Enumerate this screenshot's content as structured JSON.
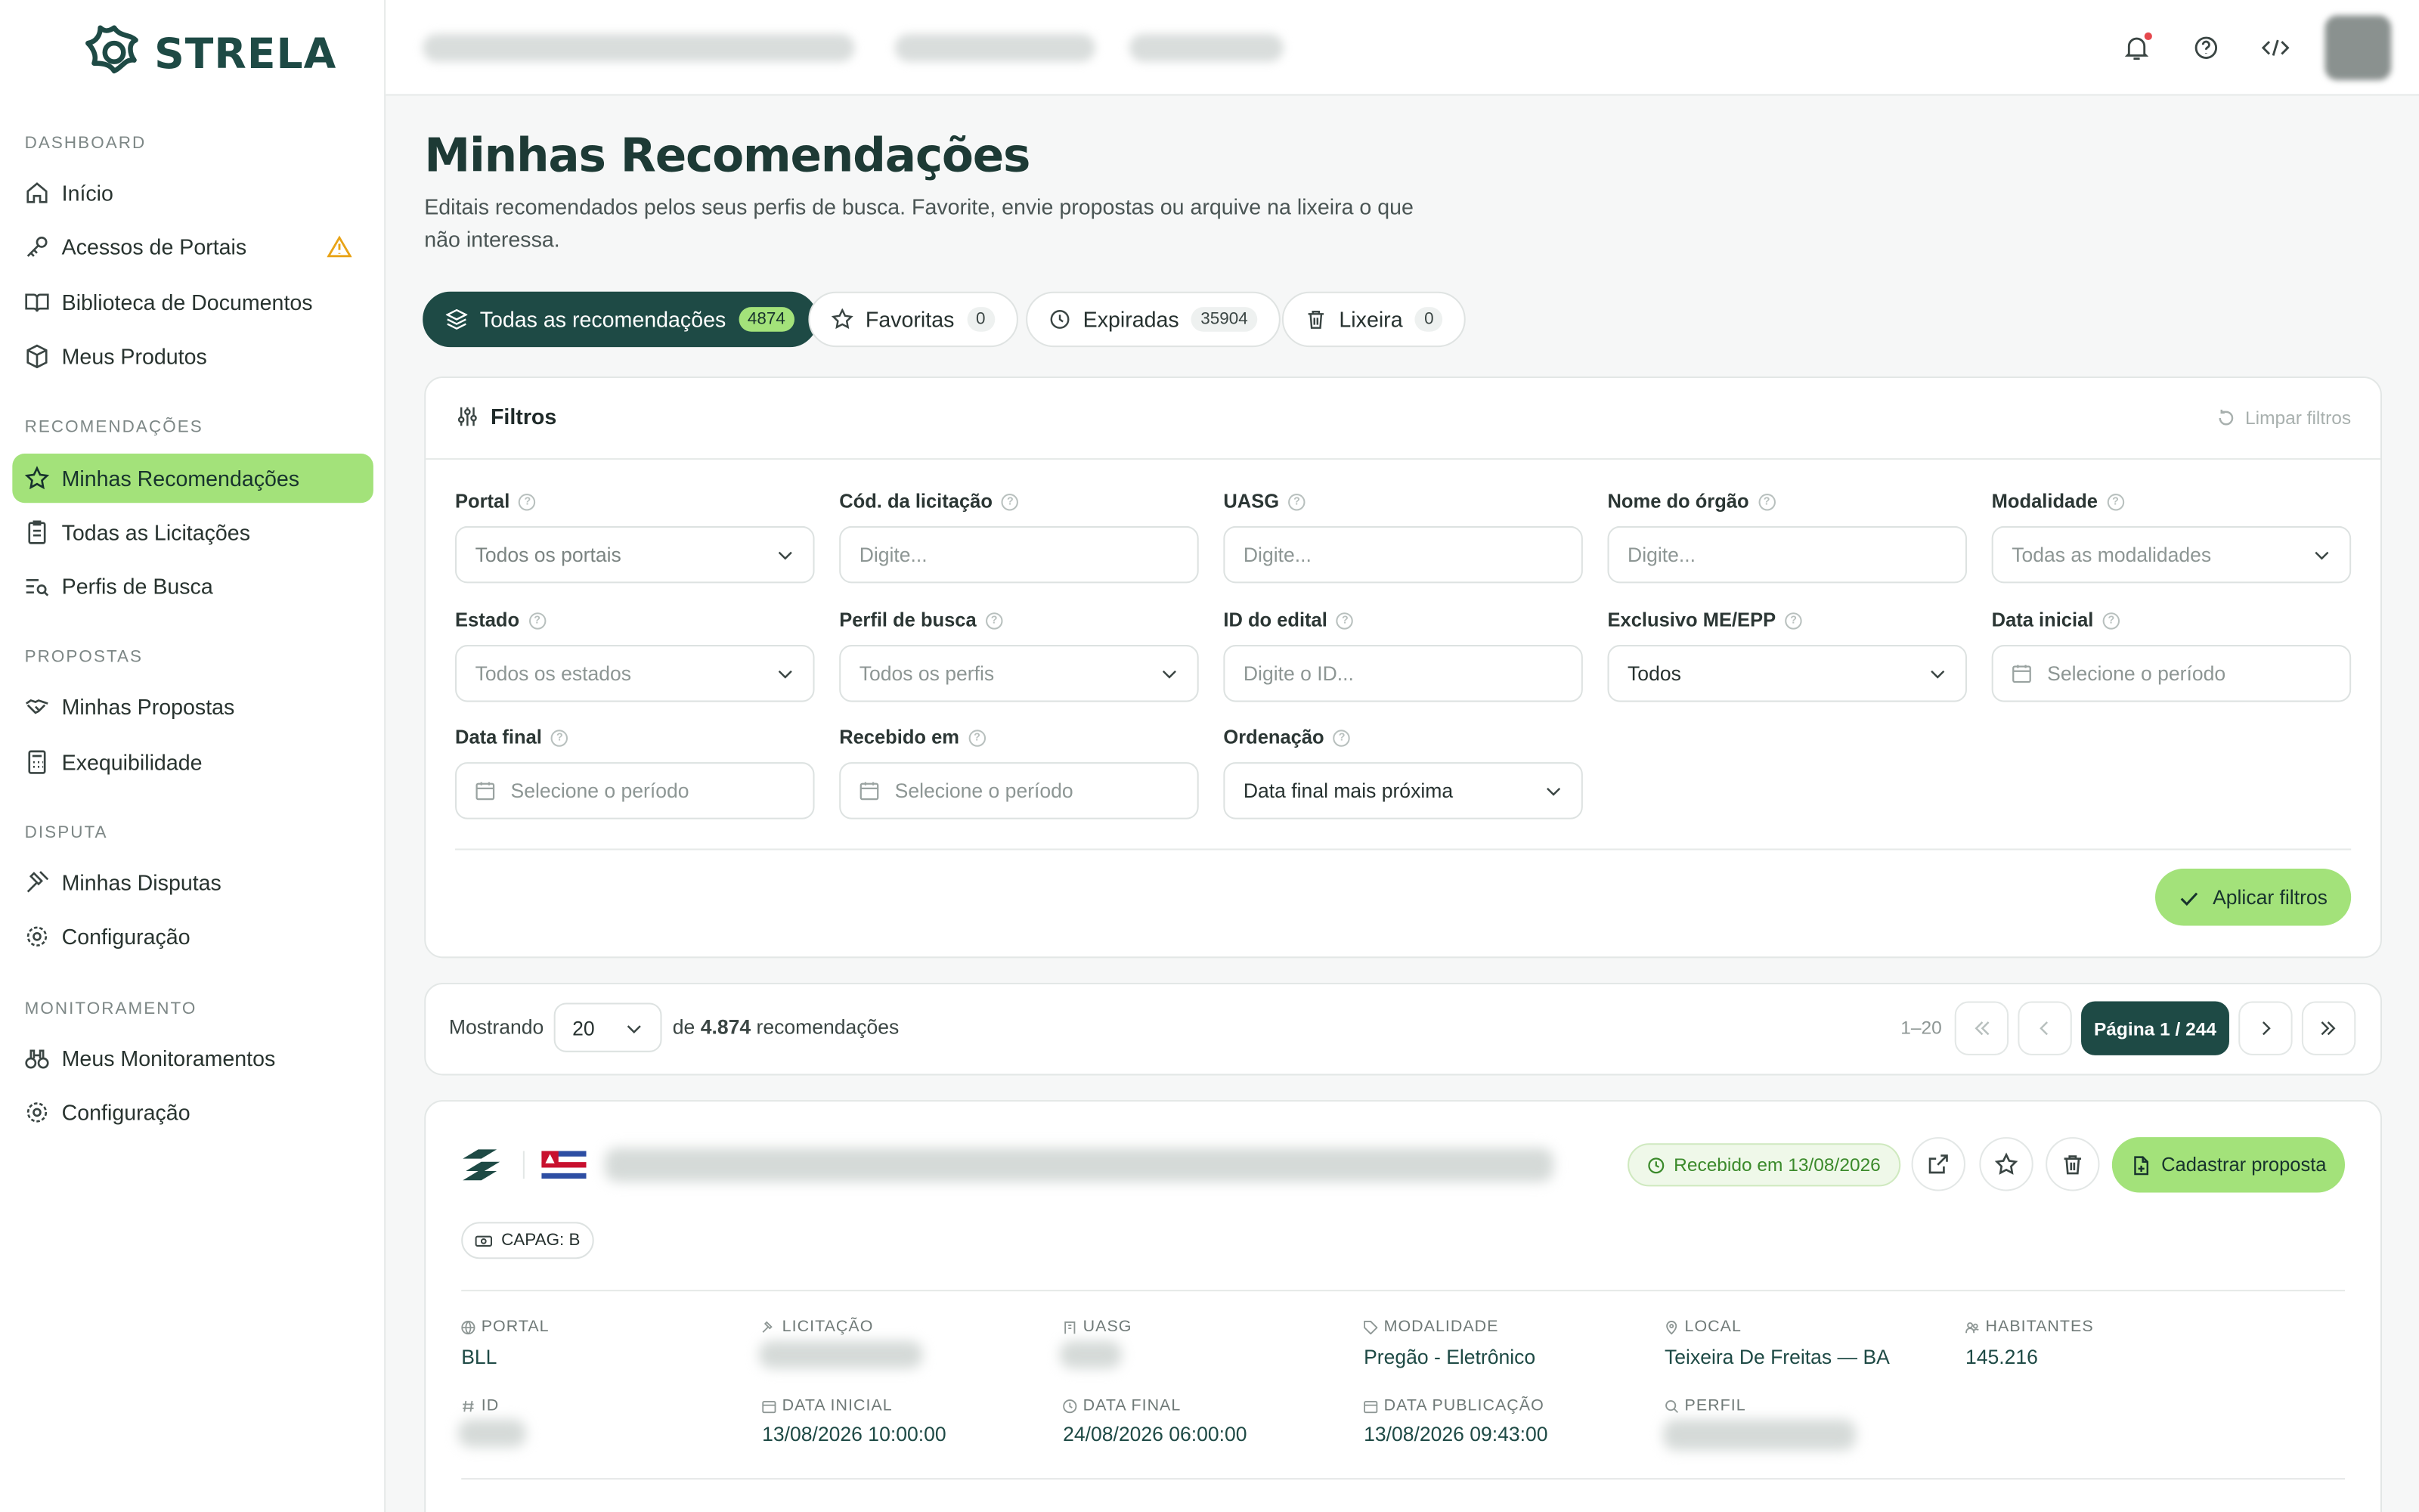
{
  "app": {
    "brand": "STRELA"
  },
  "sidebar": {
    "sections": [
      {
        "title": "DASHBOARD",
        "items": [
          {
            "label": "Início",
            "icon": "home-icon"
          },
          {
            "label": "Acessos de Portais",
            "icon": "key-icon",
            "warning": true
          },
          {
            "label": "Biblioteca de Documentos",
            "icon": "book-icon"
          },
          {
            "label": "Meus Produtos",
            "icon": "package-icon"
          }
        ]
      },
      {
        "title": "RECOMENDAÇÕES",
        "items": [
          {
            "label": "Minhas Recomendações",
            "icon": "star-icon",
            "active": true
          },
          {
            "label": "Todas as Licitações",
            "icon": "clipboard-icon"
          },
          {
            "label": "Perfis de Busca",
            "icon": "list-search-icon"
          }
        ]
      },
      {
        "title": "PROPOSTAS",
        "items": [
          {
            "label": "Minhas Propostas",
            "icon": "handshake-icon"
          },
          {
            "label": "Exequibilidade",
            "icon": "calculator-icon"
          }
        ]
      },
      {
        "title": "DISPUTA",
        "items": [
          {
            "label": "Minhas Disputas",
            "icon": "gavel-icon"
          },
          {
            "label": "Configuração",
            "icon": "gear-icon"
          }
        ]
      },
      {
        "title": "MONITORAMENTO",
        "items": [
          {
            "label": "Meus Monitoramentos",
            "icon": "binoculars-icon"
          },
          {
            "label": "Configuração",
            "icon": "gear-icon"
          }
        ]
      }
    ]
  },
  "header": {
    "icons": [
      "bell-icon",
      "help-icon",
      "code-icon"
    ]
  },
  "main": {
    "title": "Minhas Recomendações",
    "subtitle": "Editais recomendados pelos seus perfis de busca. Favorite, envie propostas ou arquive na lixeira o que não interessa.",
    "tabs": [
      {
        "label": "Todas as recomendações",
        "count": "4874",
        "active": true
      },
      {
        "label": "Favoritas",
        "count": "0"
      },
      {
        "label": "Expiradas",
        "count": "35904"
      },
      {
        "label": "Lixeira",
        "count": "0"
      }
    ],
    "filters": {
      "title": "Filtros",
      "clear_label": "Limpar filtros",
      "fields": [
        {
          "label": "Portal",
          "value": "Todos os portais"
        },
        {
          "label": "Cód. da licitação",
          "placeholder": "Digite..."
        },
        {
          "label": "UASG",
          "placeholder": "Digite..."
        },
        {
          "label": "Nome do órgão",
          "placeholder": "Digite..."
        },
        {
          "label": "Modalidade",
          "value": "Todas as modalidades"
        },
        {
          "label": "Estado",
          "value": "Todos os estados"
        },
        {
          "label": "Perfil de busca",
          "value": "Todos os perfis"
        },
        {
          "label": "ID do edital",
          "placeholder": "Digite o ID..."
        },
        {
          "label": "Exclusivo ME/EPP",
          "value": "Todos"
        },
        {
          "label": "Data inicial",
          "placeholder": "Selecione o período"
        },
        {
          "label": "Data final",
          "placeholder": "Selecione o período"
        },
        {
          "label": "Recebido em",
          "placeholder": "Selecione o período"
        },
        {
          "label": "Ordenação",
          "value": "Data final mais próxima"
        }
      ],
      "apply_label": "Aplicar filtros"
    },
    "pagination": {
      "showing_label": "Mostrando",
      "page_size": "20",
      "of_label": "de",
      "total": "4.874",
      "suffix": "recomendações",
      "range": "1–20",
      "page_label": "Página 1 / 244"
    },
    "result": {
      "received": "Recebido em 13/08/2026",
      "propose_label": "Cadastrar proposta",
      "capag": "CAPAG: B",
      "meta": [
        {
          "label": "PORTAL",
          "value": "BLL"
        },
        {
          "label": "LICITAÇÃO",
          "value": ""
        },
        {
          "label": "UASG",
          "value": ""
        },
        {
          "label": "MODALIDADE",
          "value": "Pregão - Eletrônico"
        },
        {
          "label": "LOCAL",
          "value": "Teixeira De Freitas — BA"
        },
        {
          "label": "HABITANTES",
          "value": "145.216"
        },
        {
          "label": "ID",
          "value": ""
        },
        {
          "label": "DATA INICIAL",
          "value": "13/08/2026 10:00:00"
        },
        {
          "label": "DATA FINAL",
          "value": "24/08/2026 06:00:00"
        },
        {
          "label": "DATA PUBLICAÇÃO",
          "value": "13/08/2026 09:43:00"
        },
        {
          "label": "PERFIL",
          "value": ""
        }
      ]
    }
  },
  "colors": {
    "brand": "#1e4a45",
    "accent": "#a3e27a",
    "warning": "#e8a317"
  }
}
